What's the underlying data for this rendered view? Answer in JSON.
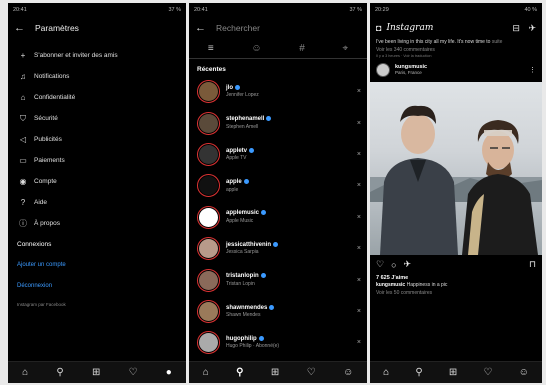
{
  "settings": {
    "time": "20:41",
    "battery": "37 %",
    "title": "Paramètres",
    "items": [
      {
        "icon": "add-person",
        "label": "S'abonner et inviter des amis"
      },
      {
        "icon": "bell",
        "label": "Notifications"
      },
      {
        "icon": "lock",
        "label": "Confidentialité"
      },
      {
        "icon": "shield",
        "label": "Sécurité"
      },
      {
        "icon": "megaphone",
        "label": "Publicités"
      },
      {
        "icon": "card",
        "label": "Paiements"
      },
      {
        "icon": "person-circle",
        "label": "Compte"
      },
      {
        "icon": "question",
        "label": "Aide"
      },
      {
        "icon": "info",
        "label": "À propos"
      }
    ],
    "connexions": "Connexions",
    "add_account": "Ajouter un compte",
    "logout": "Déconnexion",
    "facebook": "Instagram par Facebook"
  },
  "search": {
    "time": "20:41",
    "battery": "37 %",
    "placeholder": "Rechercher",
    "recents_label": "Récentes",
    "items": [
      {
        "username": "jlo",
        "name": "Jennifer Lopez",
        "color": "#7a5a3a"
      },
      {
        "username": "stephenamell",
        "name": "Stephen Amell",
        "color": "#5a4a3a"
      },
      {
        "username": "appletv",
        "name": "Apple TV",
        "color": "#333333"
      },
      {
        "username": "apple",
        "name": "apple",
        "color": "#111111"
      },
      {
        "username": "applemusic",
        "name": "Apple Music",
        "color": "#ffffff"
      },
      {
        "username": "jessicatthivenin",
        "name": "Jessica Sarpia",
        "color": "#b89a8a"
      },
      {
        "username": "tristanlopin",
        "name": "Tristan Lopin",
        "color": "#8a6a5a"
      },
      {
        "username": "shawnmendes",
        "name": "Shawn Mendes",
        "color": "#9a7a5a"
      },
      {
        "username": "hugophilip",
        "name": "Hugo Philip · Abonné(e)",
        "color": "#aaaaaa"
      }
    ]
  },
  "feed": {
    "time": "20:29",
    "battery": "40 %",
    "logo": "Instagram",
    "caption": "I've been living in this city all my life. It's now time to",
    "caption_more": "suite",
    "comments_top": "Voir les 340 commentaires",
    "tiny_line": "Il y a 3 heures · Voir la traduction",
    "post_user": "kungsmusic",
    "post_location": "Paris, France",
    "likes": "7 625 J'aime",
    "post_caption_user": "kungsmusic",
    "post_caption": "Happiness in a pic",
    "comments_bottom": "Voir les 50 commentaires"
  }
}
